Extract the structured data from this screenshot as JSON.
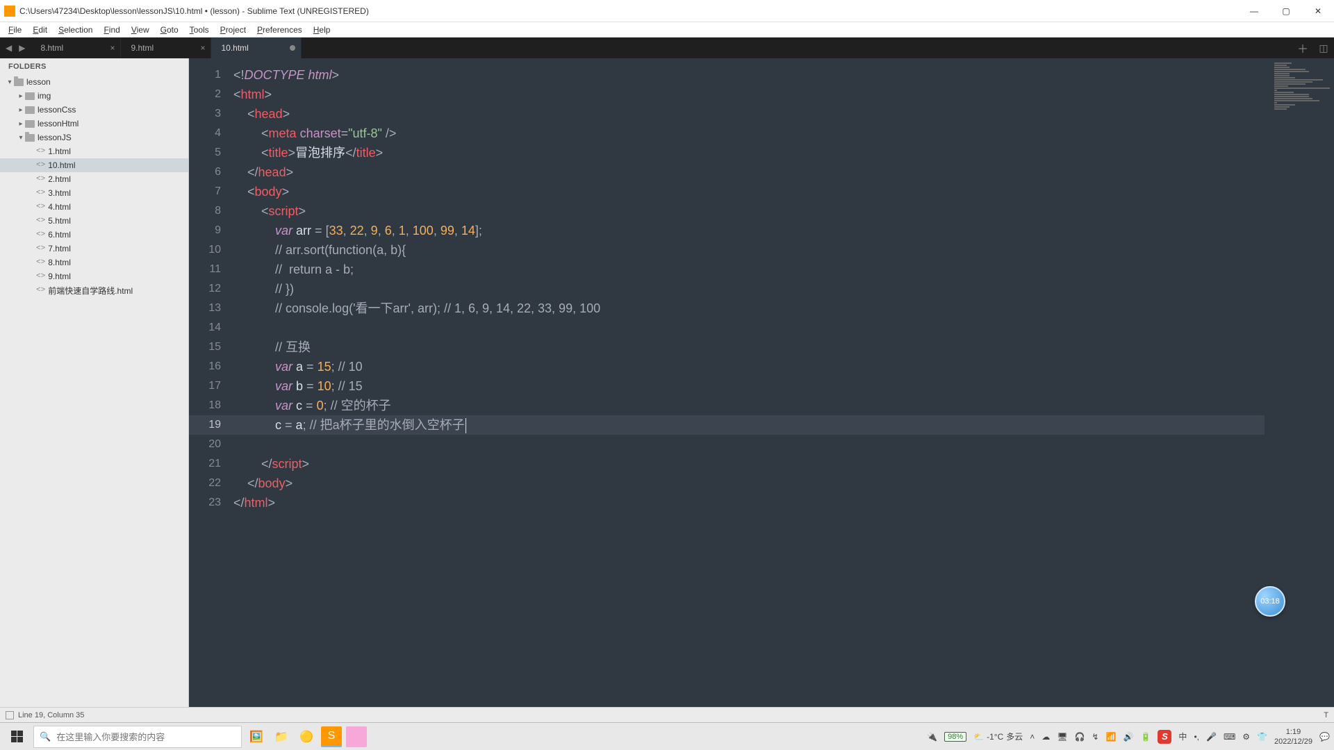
{
  "window": {
    "title": "C:\\Users\\47234\\Desktop\\lesson\\lessonJS\\10.html • (lesson) - Sublime Text (UNREGISTERED)"
  },
  "menus": [
    "File",
    "Edit",
    "Selection",
    "Find",
    "View",
    "Goto",
    "Tools",
    "Project",
    "Preferences",
    "Help"
  ],
  "tabs": [
    {
      "label": "8.html",
      "active": false,
      "dirty": false
    },
    {
      "label": "9.html",
      "active": false,
      "dirty": false
    },
    {
      "label": "10.html",
      "active": true,
      "dirty": true
    }
  ],
  "sidebar": {
    "header": "FOLDERS",
    "tree": {
      "root": "lesson",
      "children": [
        {
          "name": "img",
          "type": "folder",
          "open": false
        },
        {
          "name": "lessonCss",
          "type": "folder",
          "open": false
        },
        {
          "name": "lessonHtml",
          "type": "folder",
          "open": false
        },
        {
          "name": "lessonJS",
          "type": "folder",
          "open": true,
          "children": [
            {
              "name": "1.html",
              "type": "file"
            },
            {
              "name": "10.html",
              "type": "file",
              "selected": true
            },
            {
              "name": "2.html",
              "type": "file"
            },
            {
              "name": "3.html",
              "type": "file"
            },
            {
              "name": "4.html",
              "type": "file"
            },
            {
              "name": "5.html",
              "type": "file"
            },
            {
              "name": "6.html",
              "type": "file"
            },
            {
              "name": "7.html",
              "type": "file"
            },
            {
              "name": "8.html",
              "type": "file"
            },
            {
              "name": "9.html",
              "type": "file"
            },
            {
              "name": "前端快速自学路线.html",
              "type": "file"
            }
          ]
        }
      ]
    }
  },
  "editor": {
    "total_lines": 23,
    "highlight_line": 19,
    "code": [
      [
        [
          "<!",
          "p"
        ],
        [
          "DOCTYPE html",
          "doc"
        ],
        [
          ">",
          "p"
        ]
      ],
      [
        [
          "<",
          "p"
        ],
        [
          "html",
          "tag"
        ],
        [
          ">",
          "p"
        ]
      ],
      [
        [
          "    ",
          ""
        ],
        [
          "<",
          "p"
        ],
        [
          "head",
          "tag"
        ],
        [
          ">",
          "p"
        ]
      ],
      [
        [
          "        ",
          ""
        ],
        [
          "<",
          "p"
        ],
        [
          "meta",
          "tag"
        ],
        [
          " ",
          ""
        ],
        [
          "charset",
          "attr"
        ],
        [
          "=",
          "p"
        ],
        [
          "\"utf-8\"",
          "str"
        ],
        [
          " />",
          "p"
        ]
      ],
      [
        [
          "        ",
          ""
        ],
        [
          "<",
          "p"
        ],
        [
          "title",
          "tag"
        ],
        [
          ">",
          "p"
        ],
        [
          "冒泡排序",
          "var"
        ],
        [
          "</",
          "p"
        ],
        [
          "title",
          "tag"
        ],
        [
          ">",
          "p"
        ]
      ],
      [
        [
          "    ",
          ""
        ],
        [
          "</",
          "p"
        ],
        [
          "head",
          "tag"
        ],
        [
          ">",
          "p"
        ]
      ],
      [
        [
          "    ",
          ""
        ],
        [
          "<",
          "p"
        ],
        [
          "body",
          "tag"
        ],
        [
          ">",
          "p"
        ]
      ],
      [
        [
          "        ",
          ""
        ],
        [
          "<",
          "p"
        ],
        [
          "script",
          "tag"
        ],
        [
          ">",
          "p"
        ]
      ],
      [
        [
          "            ",
          ""
        ],
        [
          "var",
          "kw"
        ],
        [
          " arr ",
          "var"
        ],
        [
          "= ",
          "p"
        ],
        [
          "[",
          "p"
        ],
        [
          "33",
          "num"
        ],
        [
          ", ",
          "p"
        ],
        [
          "22",
          "num"
        ],
        [
          ", ",
          "p"
        ],
        [
          "9",
          "num"
        ],
        [
          ", ",
          "p"
        ],
        [
          "6",
          "num"
        ],
        [
          ", ",
          "p"
        ],
        [
          "1",
          "num"
        ],
        [
          ", ",
          "p"
        ],
        [
          "100",
          "num"
        ],
        [
          ", ",
          "p"
        ],
        [
          "99",
          "num"
        ],
        [
          ", ",
          "p"
        ],
        [
          "14",
          "num"
        ],
        [
          "];",
          "p"
        ]
      ],
      [
        [
          "            ",
          ""
        ],
        [
          "// arr.sort(function(a, b){",
          "com"
        ]
      ],
      [
        [
          "            ",
          ""
        ],
        [
          "//  return a - b;",
          "com"
        ]
      ],
      [
        [
          "            ",
          ""
        ],
        [
          "// })",
          "com"
        ]
      ],
      [
        [
          "            ",
          ""
        ],
        [
          "// console.log('看一下arr', arr); // 1, 6, 9, 14, 22, 33, 99, 100",
          "com"
        ]
      ],
      [
        [
          "",
          ""
        ]
      ],
      [
        [
          "            ",
          ""
        ],
        [
          "// 互换",
          "com"
        ]
      ],
      [
        [
          "            ",
          ""
        ],
        [
          "var",
          "kw"
        ],
        [
          " a ",
          "var"
        ],
        [
          "= ",
          "p"
        ],
        [
          "15",
          "num"
        ],
        [
          "; ",
          "p"
        ],
        [
          "// 10",
          "com"
        ]
      ],
      [
        [
          "            ",
          ""
        ],
        [
          "var",
          "kw"
        ],
        [
          " b ",
          "var"
        ],
        [
          "= ",
          "p"
        ],
        [
          "10",
          "num"
        ],
        [
          "; ",
          "p"
        ],
        [
          "// 15",
          "com"
        ]
      ],
      [
        [
          "            ",
          ""
        ],
        [
          "var",
          "kw"
        ],
        [
          " c ",
          "var"
        ],
        [
          "= ",
          "p"
        ],
        [
          "0",
          "num"
        ],
        [
          "; ",
          "p"
        ],
        [
          "// 空的杯子",
          "com"
        ]
      ],
      [
        [
          "            ",
          ""
        ],
        [
          "c ",
          "var"
        ],
        [
          "= ",
          "p"
        ],
        [
          "a",
          "var"
        ],
        [
          "; ",
          "p"
        ],
        [
          "// 把a杯子里的水倒入空杯子",
          "com"
        ]
      ],
      [
        [
          "",
          ""
        ]
      ],
      [
        [
          "        ",
          ""
        ],
        [
          "</",
          "p"
        ],
        [
          "script",
          "tag"
        ],
        [
          ">",
          "p"
        ]
      ],
      [
        [
          "    ",
          ""
        ],
        [
          "</",
          "p"
        ],
        [
          "body",
          "tag"
        ],
        [
          ">",
          "p"
        ]
      ],
      [
        [
          "</",
          "p"
        ],
        [
          "html",
          "tag"
        ],
        [
          ">",
          "p"
        ]
      ]
    ]
  },
  "status": {
    "left": "Line 19, Column 35",
    "right_lang": "T"
  },
  "taskbar": {
    "search_placeholder": "在这里输入你要搜索的内容",
    "battery": "98%",
    "weather_temp": "-1°C",
    "weather_text": "多云",
    "time": "1:19",
    "date": "2022/12/29"
  },
  "timer": "03:18"
}
